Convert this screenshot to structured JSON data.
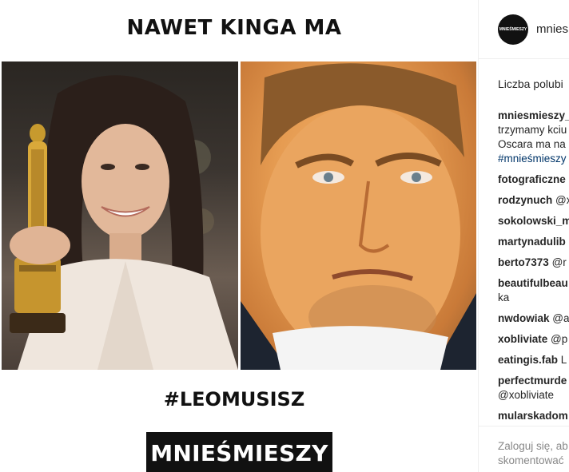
{
  "meme": {
    "top_caption": "NAWET KINGA MA",
    "hashtag": "#LEOMUSISZ",
    "logo_text": "MNIEŚMIESZY"
  },
  "sidebar": {
    "avatar_text": "MNIEŚMIESZY",
    "username": "mnies",
    "likes_label": "Liczba polubi",
    "caption": {
      "user": "mniesmieszy_",
      "line2": "trzymamy kciu",
      "line3": "Oscara ma na",
      "tag": "#mnieśmieszy"
    },
    "comments": [
      {
        "user": "fotograficzne",
        "text": ""
      },
      {
        "user": "rodzynuch",
        "text": "@x"
      },
      {
        "user": "sokolowski_m",
        "text": ""
      },
      {
        "user": "martynadulib",
        "text": ""
      },
      {
        "user": "berto7373",
        "text": "@r"
      },
      {
        "user": "beautifulbeau",
        "text": "",
        "line2": "ka"
      },
      {
        "user": "nwdowiak",
        "text": "@a"
      },
      {
        "user": "xobliviate",
        "text": "@p"
      },
      {
        "user": "eatingis.fab",
        "text": "L"
      },
      {
        "user": "perfectmurde",
        "text": "",
        "line2": "@xobliviate"
      },
      {
        "user": "mularskadom",
        "text": ""
      }
    ],
    "login_line1": "Zaloguj się, ab",
    "login_line2": "skomentować"
  }
}
